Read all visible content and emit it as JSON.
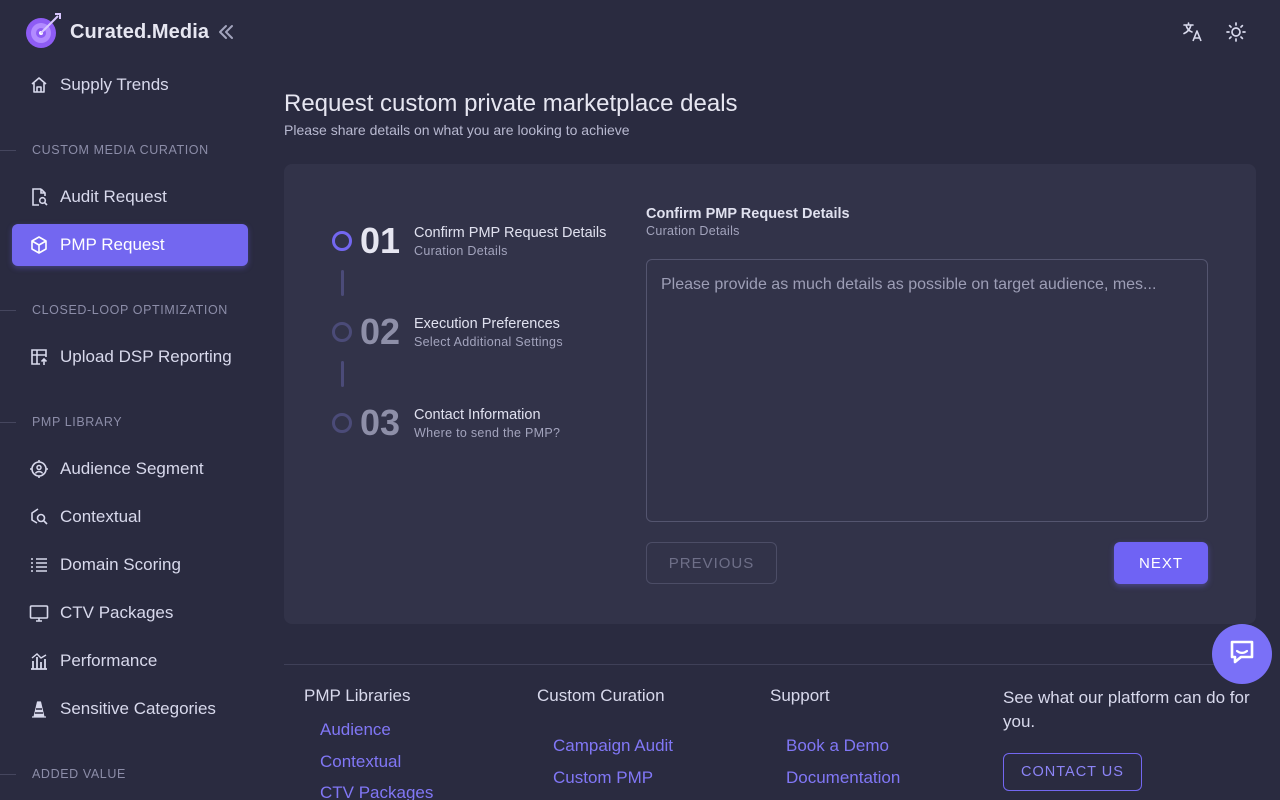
{
  "brand": {
    "name": "Curated.Media"
  },
  "colors": {
    "accent": "#7367f0",
    "background": "#2a2b40",
    "card": "#323349"
  },
  "sidebar": {
    "top_item": {
      "label": "Supply Trends",
      "icon": "home-icon"
    },
    "sections": [
      {
        "label": "CUSTOM MEDIA CURATION"
      },
      {
        "label": "CLOSED-LOOP OPTIMIZATION"
      },
      {
        "label": "PMP LIBRARY"
      },
      {
        "label": "ADDED VALUE"
      }
    ],
    "items": [
      {
        "label": "Audit Request",
        "icon": "file-search-icon"
      },
      {
        "label": "PMP Request",
        "icon": "cube-icon",
        "active": true
      },
      {
        "label": "Upload DSP Reporting",
        "icon": "table-upload-icon"
      },
      {
        "label": "Audience Segment",
        "icon": "target-user-icon"
      },
      {
        "label": "Contextual",
        "icon": "zoom-scan-icon"
      },
      {
        "label": "Domain Scoring",
        "icon": "list-numbers-icon"
      },
      {
        "label": "CTV Packages",
        "icon": "monitor-icon"
      },
      {
        "label": "Performance",
        "icon": "chart-icon"
      },
      {
        "label": "Sensitive Categories",
        "icon": "traffic-cone-icon"
      }
    ]
  },
  "header": {
    "translate_icon": "language-icon",
    "theme_icon": "sun-icon"
  },
  "main": {
    "title": "Request custom private marketplace deals",
    "subtitle": "Please share details on what you are looking to achieve"
  },
  "stepper": {
    "steps": [
      {
        "number": "01",
        "title": "Confirm PMP Request Details",
        "subtitle": "Curation Details",
        "active": true
      },
      {
        "number": "02",
        "title": "Execution Preferences",
        "subtitle": "Select Additional Settings",
        "active": false
      },
      {
        "number": "03",
        "title": "Contact Information",
        "subtitle": "Where to send the PMP?",
        "active": false
      }
    ]
  },
  "form": {
    "title": "Confirm PMP Request Details",
    "subtitle": "Curation Details",
    "textarea_placeholder": "Please provide as much details as possible on target audience, mes...",
    "textarea_value": "",
    "previous_label": "PREVIOUS",
    "next_label": "NEXT"
  },
  "footer": {
    "columns": [
      {
        "heading": "PMP Libraries",
        "links": [
          "Audience",
          "Contextual",
          "CTV Packages"
        ]
      },
      {
        "heading": "Custom Curation",
        "links": [
          "Campaign Audit",
          "Custom PMP"
        ]
      },
      {
        "heading": "Support",
        "links": [
          "Book a Demo",
          "Documentation"
        ]
      }
    ],
    "cta_text": "See what our platform can do for you.",
    "contact_label": "CONTACT US"
  },
  "chat": {
    "icon": "chat-icon"
  }
}
